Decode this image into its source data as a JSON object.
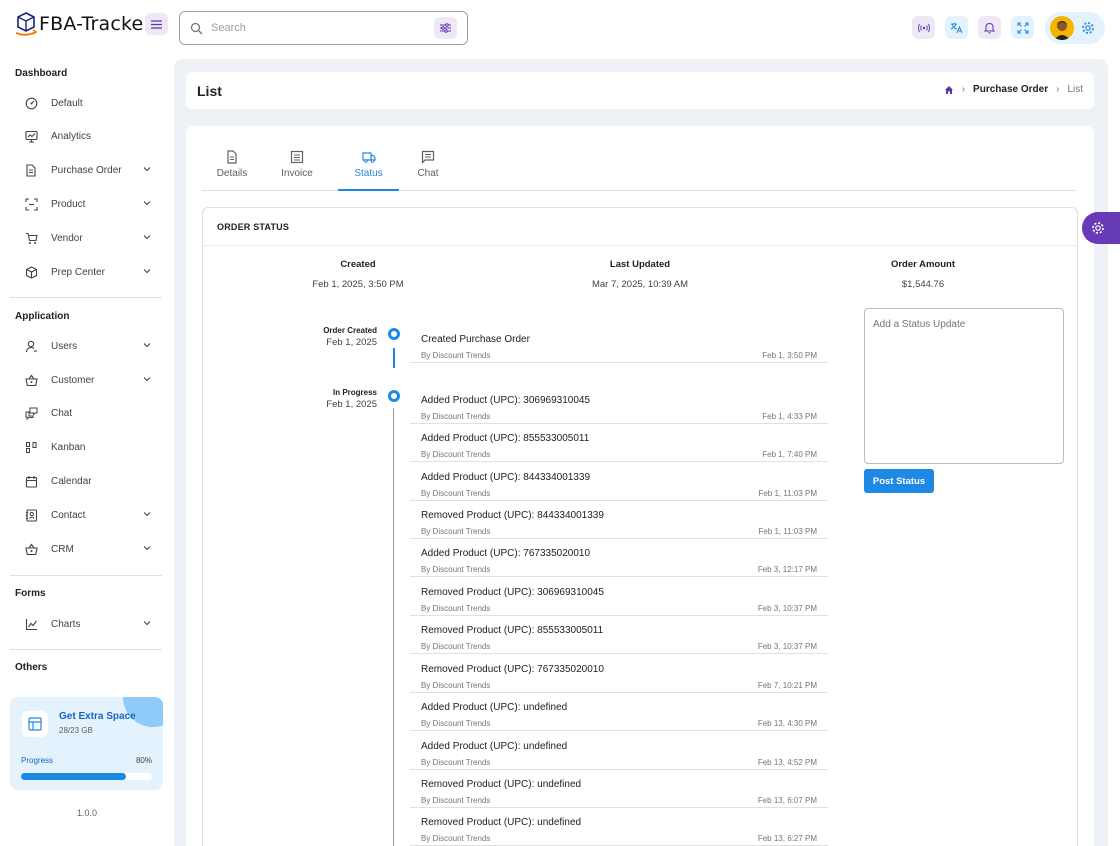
{
  "app": {
    "name": "FBA-Tracker"
  },
  "search": {
    "placeholder": "Search"
  },
  "sidebar": {
    "sections": [
      {
        "title": "Dashboard"
      },
      {
        "title": "Application"
      },
      {
        "title": "Forms"
      },
      {
        "title": "Others"
      }
    ],
    "items": [
      {
        "label": "Default",
        "icon": "dashboard-icon"
      },
      {
        "label": "Analytics",
        "icon": "analytics-icon"
      },
      {
        "label": "Purchase Order",
        "icon": "document-icon"
      },
      {
        "label": "Product",
        "icon": "barcode-icon"
      },
      {
        "label": "Vendor",
        "icon": "cart-icon"
      },
      {
        "label": "Prep Center",
        "icon": "box-icon"
      },
      {
        "label": "Users",
        "icon": "user-icon"
      },
      {
        "label": "Customer",
        "icon": "basket-icon"
      },
      {
        "label": "Chat",
        "icon": "chat-icon"
      },
      {
        "label": "Kanban",
        "icon": "kanban-icon"
      },
      {
        "label": "Calendar",
        "icon": "calendar-icon"
      },
      {
        "label": "Contact",
        "icon": "contact-icon"
      },
      {
        "label": "CRM",
        "icon": "crm-icon"
      },
      {
        "label": "Charts",
        "icon": "chart-icon"
      }
    ],
    "promo": {
      "title": "Get Extra Space",
      "subtitle": "28/23 GB",
      "progress_label": "Progress",
      "progress_text": "80%",
      "progress_value": 0.8
    },
    "version": "1.0.0"
  },
  "page": {
    "title": "List",
    "breadcrumb": {
      "parent": "Purchase Order",
      "current": "List"
    }
  },
  "tabs": [
    {
      "label": "Details"
    },
    {
      "label": "Invoice"
    },
    {
      "label": "Status"
    },
    {
      "label": "Chat"
    }
  ],
  "order_status": {
    "title": "ORDER STATUS",
    "summary": [
      {
        "label": "Created",
        "value": "Feb 1, 2025, 3:50 PM"
      },
      {
        "label": "Last Updated",
        "value": "Mar 7, 2025, 10:39 AM"
      },
      {
        "label": "Order Amount",
        "value": "$1,544.76"
      }
    ],
    "groups": [
      {
        "label": "Order Created",
        "date": "Feb 1, 2025"
      },
      {
        "label": "In Progress",
        "date": "Feb 1, 2025"
      }
    ],
    "entries": [
      {
        "title": "Created Purchase Order",
        "by": "By Discount Trends",
        "time": "Feb 1, 3:50 PM"
      },
      {
        "title": "Added Product (UPC): 306969310045",
        "by": "By Discount Trends",
        "time": "Feb 1, 4:33 PM"
      },
      {
        "title": "Added Product (UPC): 855533005011",
        "by": "By Discount Trends",
        "time": "Feb 1, 7:40 PM"
      },
      {
        "title": "Added Product (UPC): 844334001339",
        "by": "By Discount Trends",
        "time": "Feb 1, 11:03 PM"
      },
      {
        "title": "Removed Product (UPC): 844334001339",
        "by": "By Discount Trends",
        "time": "Feb 1, 11:03 PM"
      },
      {
        "title": "Added Product (UPC): 767335020010",
        "by": "By Discount Trends",
        "time": "Feb 3, 12:17 PM"
      },
      {
        "title": "Removed Product (UPC): 306969310045",
        "by": "By Discount Trends",
        "time": "Feb 3, 10:37 PM"
      },
      {
        "title": "Removed Product (UPC): 855533005011",
        "by": "By Discount Trends",
        "time": "Feb 3, 10:37 PM"
      },
      {
        "title": "Removed Product (UPC): 767335020010",
        "by": "By Discount Trends",
        "time": "Feb 7, 10:21 PM"
      },
      {
        "title": "Added Product (UPC): undefined",
        "by": "By Discount Trends",
        "time": "Feb 13, 4:30 PM"
      },
      {
        "title": "Added Product (UPC): undefined",
        "by": "By Discount Trends",
        "time": "Feb 13, 4:52 PM"
      },
      {
        "title": "Removed Product (UPC): undefined",
        "by": "By Discount Trends",
        "time": "Feb 13, 6:07 PM"
      },
      {
        "title": "Removed Product (UPC): undefined",
        "by": "By Discount Trends",
        "time": "Feb 13, 6:27 PM"
      }
    ],
    "status_update": {
      "placeholder": "Add a Status Update",
      "button": "Post Status"
    }
  },
  "colors": {
    "primary": "#1e88e5",
    "secondary": "#673ab7",
    "background": "#eef2f6"
  }
}
